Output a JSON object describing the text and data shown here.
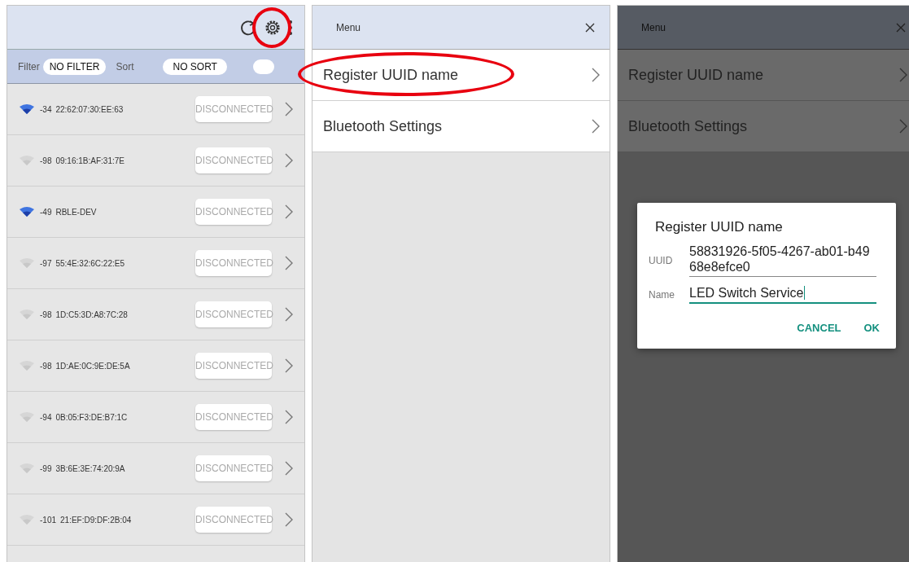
{
  "device_list": {
    "settings_highlighted": true,
    "filter_label": "Filter",
    "filter_value": "NO FILTER",
    "sort_label": "Sort",
    "sort_value": "NO SORT",
    "toggle_on": false,
    "devices": [
      {
        "rssi": "-34",
        "name": "22:62:07:30:EE:63",
        "strong": true,
        "status": "DISCONNECTED"
      },
      {
        "rssi": "-98",
        "name": "09:16:1B:AF:31:7E",
        "strong": false,
        "status": "DISCONNECTED"
      },
      {
        "rssi": "-49",
        "name": "RBLE-DEV",
        "strong": true,
        "status": "DISCONNECTED"
      },
      {
        "rssi": "-97",
        "name": "55:4E:32:6C:22:E5",
        "strong": false,
        "status": "DISCONNECTED"
      },
      {
        "rssi": "-98",
        "name": "1D:C5:3D:A8:7C:28",
        "strong": false,
        "status": "DISCONNECTED"
      },
      {
        "rssi": "-98",
        "name": "1D:AE:0C:9E:DE:5A",
        "strong": false,
        "status": "DISCONNECTED"
      },
      {
        "rssi": "-94",
        "name": "0B:05:F3:DE:B7:1C",
        "strong": false,
        "status": "DISCONNECTED"
      },
      {
        "rssi": "-99",
        "name": "3B:6E:3E:74:20:9A",
        "strong": false,
        "status": "DISCONNECTED"
      },
      {
        "rssi": "-101",
        "name": "21:EF:D9:DF:2B:04",
        "strong": false,
        "status": "DISCONNECTED"
      }
    ]
  },
  "menu_panel": {
    "title": "Menu",
    "items": [
      {
        "label": "Register UUID name",
        "highlighted": true
      },
      {
        "label": "Bluetooth Settings",
        "highlighted": false
      }
    ]
  },
  "dialog_screen": {
    "menu_title": "Menu",
    "menu_items": [
      "Register UUID name",
      "Bluetooth Settings"
    ],
    "dialog": {
      "title": "Register UUID name",
      "fields": [
        {
          "label": "UUID",
          "value": "58831926-5f05-4267-ab01-b4968e8efce0",
          "focused": false
        },
        {
          "label": "Name",
          "value": "LED Switch Service",
          "focused": true
        }
      ],
      "buttons": [
        "CANCEL",
        "OK"
      ]
    }
  }
}
